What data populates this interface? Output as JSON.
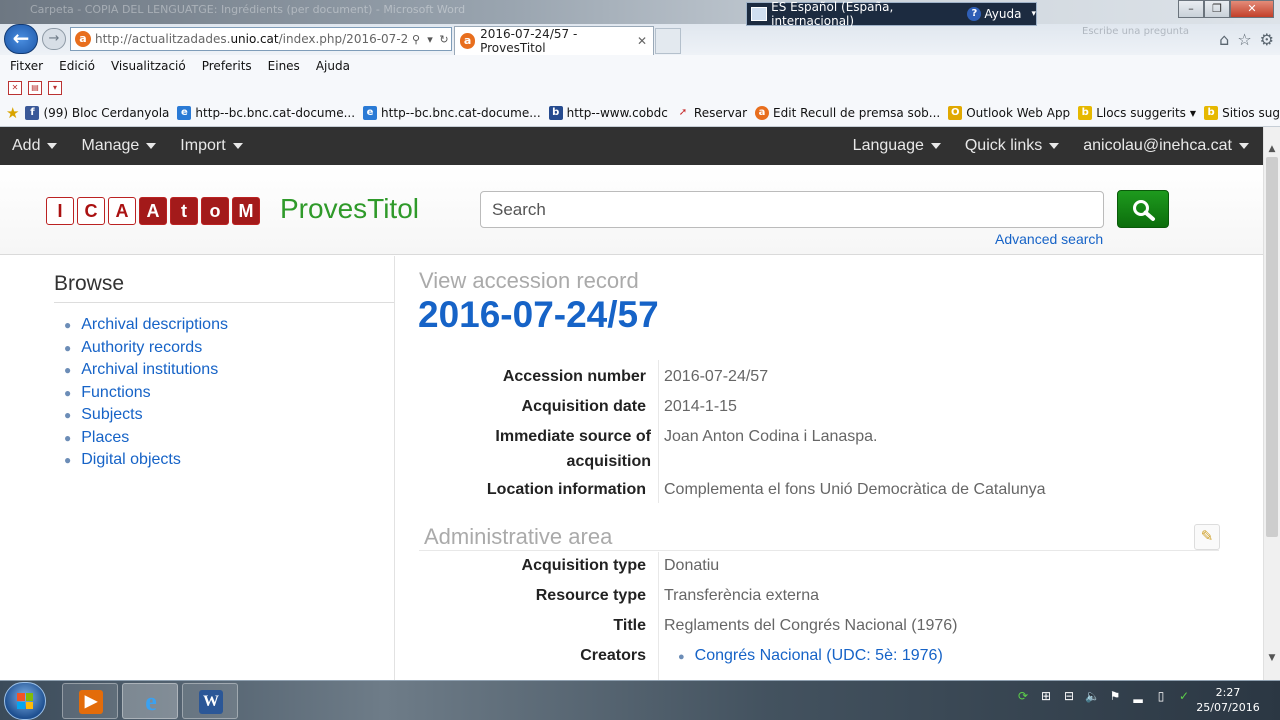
{
  "browser": {
    "ghost_title": "Carpeta - COPIA DEL LENGUATGE: Ingrédients (per document) - Microsoft Word",
    "language_bar": {
      "language": "ES Español (España, internacional)",
      "help": "Ayuda"
    },
    "ghost_search": "Escribe una pregunta",
    "address": {
      "url_prefix": "http://actualitzadades.",
      "url_domain": "unio.cat",
      "url_suffix": "/index.php/2016-07-24-57"
    },
    "active_tab": "2016-07-24/57 - ProvesTitol",
    "menu": [
      "Fitxer",
      "Edició",
      "Visualització",
      "Preferits",
      "Eines",
      "Ajuda"
    ],
    "favorites": [
      {
        "label": "(99) Bloc Cerdanyola",
        "icon": "facebook-icon",
        "color": "#3b5998"
      },
      {
        "label": "http--bc.bnc.cat-docume...",
        "icon": "ie-page-icon",
        "color": "#2a7ad5"
      },
      {
        "label": "http--bc.bnc.cat-docume...",
        "icon": "ie-page-icon",
        "color": "#2a7ad5"
      },
      {
        "label": "http--www.cobdc",
        "icon": "bdc-icon",
        "color": "#264b8f"
      },
      {
        "label": "Reservar",
        "icon": "arrow-icon",
        "color": "#c62828"
      },
      {
        "label": "Edit Recull de premsa sob...",
        "icon": "atom-icon",
        "color": "#e86e1d"
      },
      {
        "label": "Outlook Web App",
        "icon": "outlook-icon",
        "color": "#e0a800"
      },
      {
        "label": "Llocs suggerits",
        "icon": "bing-icon",
        "color": "#e6b800"
      },
      {
        "label": "Sitios sugeridos",
        "icon": "bing-icon",
        "color": "#e6b800"
      }
    ]
  },
  "app": {
    "topnav": {
      "left": [
        "Add",
        "Manage",
        "Import"
      ],
      "right": [
        "Language",
        "Quick links",
        "anicolau@inehca.cat"
      ]
    },
    "logo_letters": [
      "I",
      "C",
      "A",
      "A",
      "t",
      "o",
      "M"
    ],
    "site_title": "ProvesTitol",
    "search_placeholder": "Search",
    "advanced_search": "Advanced search",
    "sidebar": {
      "heading": "Browse",
      "items": [
        "Archival descriptions",
        "Authority records",
        "Archival institutions",
        "Functions",
        "Subjects",
        "Places",
        "Digital objects"
      ]
    },
    "record": {
      "view_label": "View accession record",
      "title": "2016-07-24/57",
      "identity_fields": [
        {
          "label": "Accession number",
          "value": "2016-07-24/57"
        },
        {
          "label": "Acquisition date",
          "value": "2014-1-15"
        },
        {
          "label": "Immediate source of acquisition",
          "value": "Joan Anton Codina i Lanaspa."
        },
        {
          "label": "Location information",
          "value": "Complementa el fons Unió Democràtica de Catalunya"
        }
      ],
      "admin_area": {
        "heading": "Administrative area",
        "fields": [
          {
            "label": "Acquisition type",
            "value": "Donatiu"
          },
          {
            "label": "Resource type",
            "value": "Transferència externa"
          },
          {
            "label": "Title",
            "value": "Reglaments del Congrés Nacional (1976)"
          }
        ],
        "creators_label": "Creators",
        "creators": [
          "Congrés Nacional (UDC: 5è: 1976)"
        ]
      }
    }
  },
  "taskbar": {
    "time": "2:27",
    "date": "25/07/2016"
  }
}
